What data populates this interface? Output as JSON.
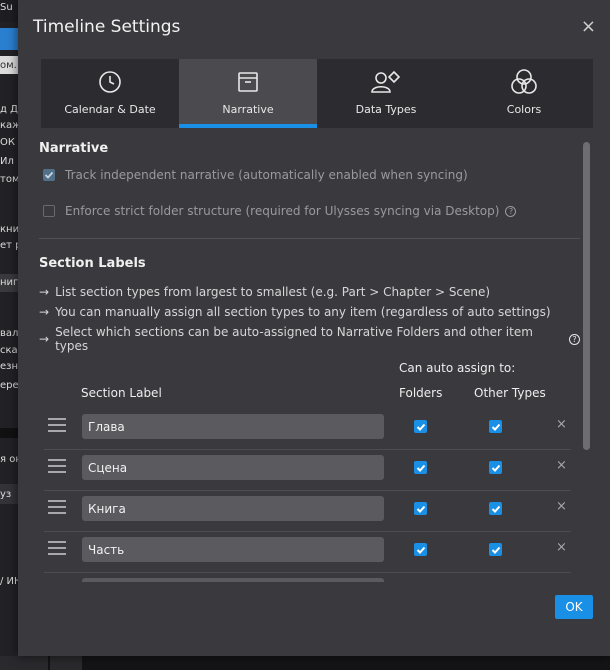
{
  "background": {
    "fragments": [
      "Su",
      "ом. I",
      "д ДА",
      "каж",
      "ОК",
      "Ил",
      "том",
      "кни",
      "ет р",
      "нига",
      "вал",
      "ска",
      "езн",
      "ере",
      "я он",
      "уз",
      "/ ИН"
    ]
  },
  "dialog": {
    "title": "Timeline Settings",
    "close_glyph": "×",
    "tabs": [
      {
        "label": "Calendar & Date",
        "icon": "clock-icon",
        "active": false
      },
      {
        "label": "Narrative",
        "icon": "archive-box-icon",
        "active": true
      },
      {
        "label": "Data Types",
        "icon": "person-diamond-icon",
        "active": false
      },
      {
        "label": "Colors",
        "icon": "color-circles-icon",
        "active": false
      }
    ],
    "narrative": {
      "heading": "Narrative",
      "track_label": "Track independent narrative (automatically enabled when syncing)",
      "track_checked": true,
      "enforce_label": "Enforce strict folder structure (required for Ulysses syncing via Desktop)",
      "enforce_checked": false
    },
    "section_labels": {
      "heading": "Section Labels",
      "bullets": [
        "List section types from largest to smallest (e.g. Part > Chapter > Scene)",
        "You can manually assign all section types to any item (regardless of auto settings)",
        "Select which sections can be auto-assigned to Narrative Folders and other item types"
      ],
      "auto_assign_header": "Can auto assign to:",
      "col_label": "Section Label",
      "col_folders": "Folders",
      "col_other": "Other Types",
      "rows": [
        {
          "label": "Глава",
          "folders": true,
          "other": true
        },
        {
          "label": "Сцена",
          "folders": true,
          "other": true
        },
        {
          "label": "Книга",
          "folders": true,
          "other": true
        },
        {
          "label": "Часть",
          "folders": true,
          "other": true
        },
        {
          "label": "",
          "folders": true,
          "other": true
        }
      ],
      "remove_glyph": "×"
    },
    "ok_label": "OK",
    "colors": {
      "accent": "#1a8fe6",
      "panel": "#3a3a3e",
      "tab_bar": "#2c2c30"
    }
  }
}
